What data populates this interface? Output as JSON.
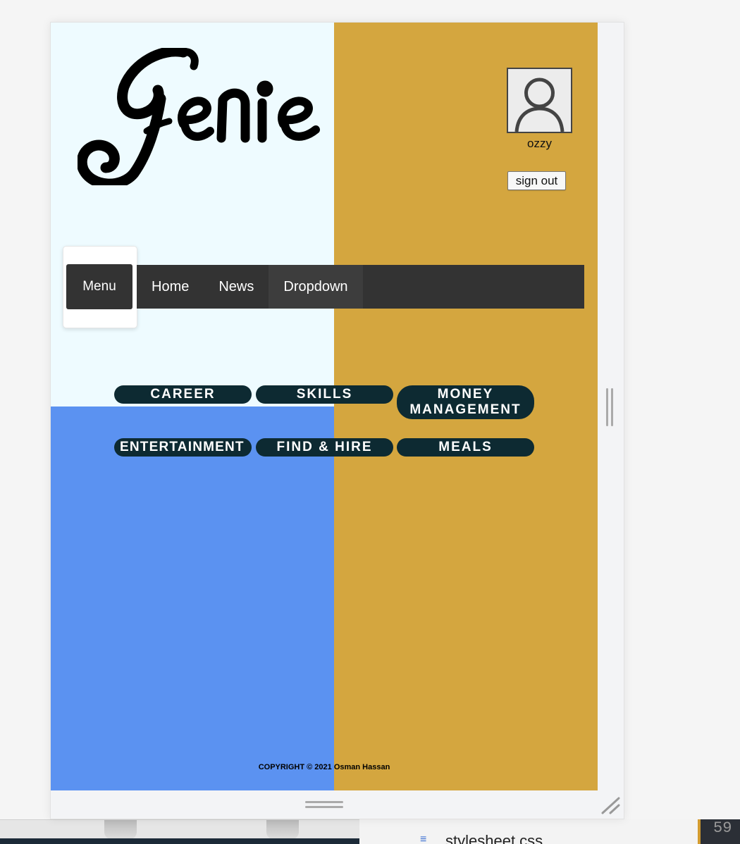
{
  "header": {
    "logo_text": "Genie",
    "user": {
      "name": "ozzy",
      "signout_label": "sign out"
    }
  },
  "nav": {
    "menu_label": "Menu",
    "items": [
      {
        "label": "Home"
      },
      {
        "label": "News"
      },
      {
        "label": "Dropdown"
      }
    ]
  },
  "categories": [
    {
      "label": "CAREER"
    },
    {
      "label": "SKILLS"
    },
    {
      "label": "MONEY MANAGEMENT"
    },
    {
      "label": "ENTERTAINMENT"
    },
    {
      "label": "FIND & HIRE"
    },
    {
      "label": "MEALS"
    }
  ],
  "footer": {
    "copyright": "COPYRIGHT © 2021 Osman Hassan"
  },
  "background_editor": {
    "file_name": "stylesheet.css",
    "line_number": "59"
  },
  "colors": {
    "top_left": "#eefbff",
    "bottom_left": "#5b92f1",
    "right": "#d4a63f",
    "nav_bg": "#333333",
    "pill_bg": "#0d2a32"
  }
}
